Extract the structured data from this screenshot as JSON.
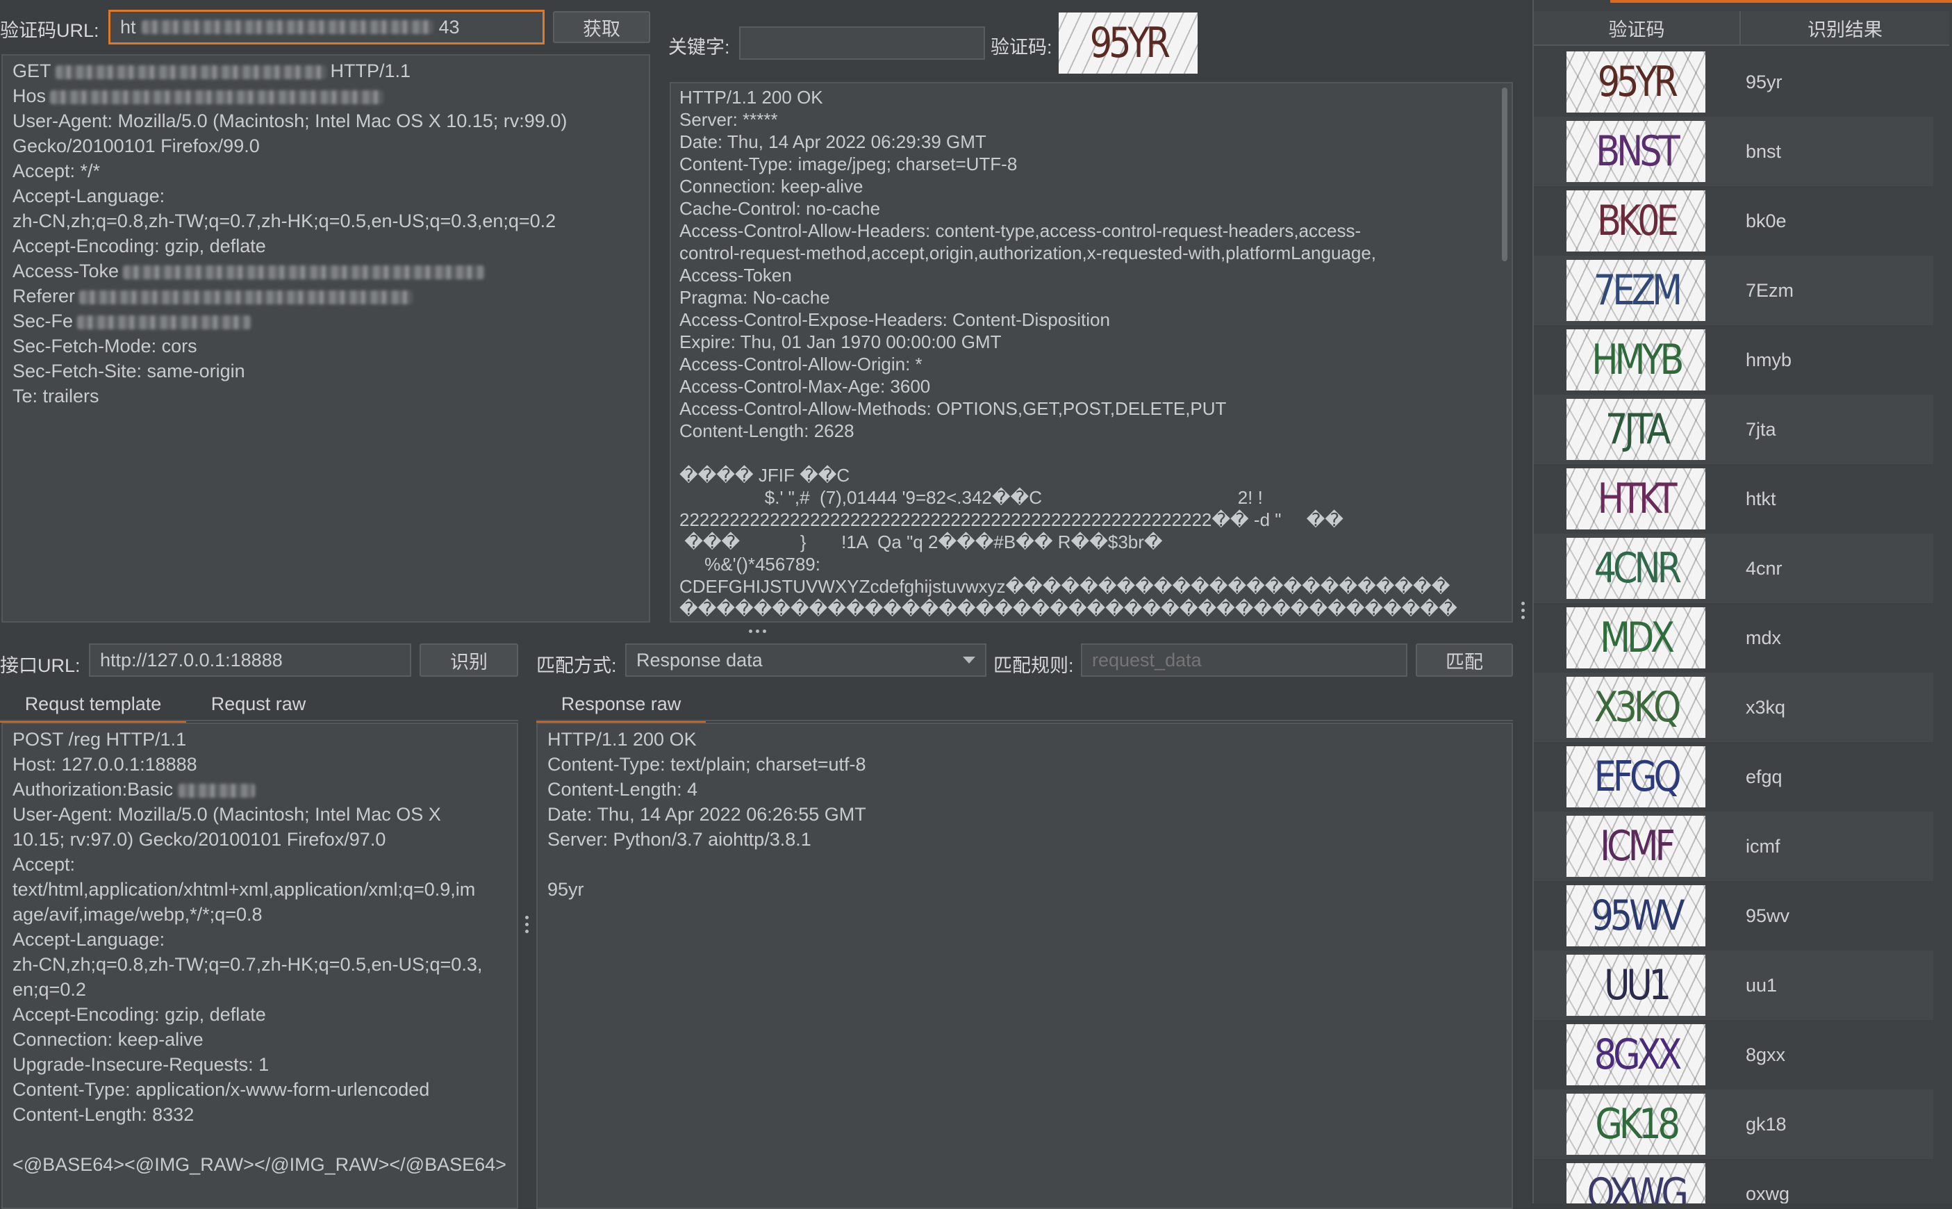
{
  "top": {
    "captcha_url_label": "验证码URL:",
    "captcha_url_value_start": "ht",
    "captcha_url_value_end": "43",
    "fetch_button": "获取",
    "keyword_label": "关键字:",
    "captcha_label": "验证码:",
    "captcha_text": "95YR"
  },
  "request_lines": [
    "GET",
    "Hos",
    "User-Agent: Mozilla/5.0 (Macintosh; Intel Mac OS X 10.15; rv:99.0)",
    "Gecko/20100101 Firefox/99.0",
    "Accept: */*",
    "Accept-Language:",
    "zh-CN,zh;q=0.8,zh-TW;q=0.7,zh-HK;q=0.5,en-US;q=0.3,en;q=0.2",
    "Accept-Encoding: gzip, deflate",
    "Access-Toke",
    "Referer",
    "Sec-Fe",
    "Sec-Fetch-Mode: cors",
    "Sec-Fetch-Site: same-origin",
    "Te: trailers"
  ],
  "request_line0_tail": "HTTP/1.1",
  "response_lines": [
    "HTTP/1.1 200 OK",
    "Server: *****",
    "Date: Thu, 14 Apr 2022 06:29:39 GMT",
    "Content-Type: image/jpeg; charset=UTF-8",
    "Connection: keep-alive",
    "Cache-Control: no-cache",
    "Access-Control-Allow-Headers: content-type,access-control-request-headers,access-",
    "control-request-method,accept,origin,authorization,x-requested-with,platformLanguage,",
    "Access-Token",
    "Pragma: No-cache",
    "Access-Control-Expose-Headers: Content-Disposition",
    "Expire: Thu, 01 Jan 1970 00:00:00 GMT",
    "Access-Control-Allow-Origin: *",
    "Access-Control-Max-Age: 3600",
    "Access-Control-Allow-Methods: OPTIONS,GET,POST,DELETE,PUT",
    "Content-Length: 2628",
    "",
    "���� JFIF ��C",
    "                 $.' \",#  (7),01444 '9=82<.342��C                                       2! !",
    "22222222222222222222222222222222222222222222222222222�� -d \"     ��",
    " ���            }       !1A  Qa \"q 2���#B�� R��$3br�",
    "     %&'()*456789:",
    "CDEFGHIJSTUVWXYZcdefghijstuvwxyz������������������������",
    "������������������������������������������"
  ],
  "middle": {
    "api_url_label": "接口URL:",
    "api_url_value": "http://127.0.0.1:18888",
    "recognize_button": "识别",
    "match_mode_label": "匹配方式:",
    "match_mode_value": "Response data",
    "match_rule_label": "匹配规则:",
    "match_rule_placeholder": "request_data",
    "match_button": "匹配"
  },
  "tabs": {
    "template": "Requst template",
    "raw": "Requst raw",
    "response_raw": "Response raw"
  },
  "template_lines": [
    "POST /reg HTTP/1.1",
    "Host: 127.0.0.1:18888",
    "Authorization:Basic",
    "User-Agent: Mozilla/5.0 (Macintosh; Intel Mac OS X",
    "10.15; rv:97.0) Gecko/20100101 Firefox/97.0",
    "Accept:",
    "text/html,application/xhtml+xml,application/xml;q=0.9,im",
    "age/avif,image/webp,*/*;q=0.8",
    "Accept-Language:",
    "zh-CN,zh;q=0.8,zh-TW;q=0.7,zh-HK;q=0.5,en-US;q=0.3,",
    "en;q=0.2",
    "Accept-Encoding: gzip, deflate",
    "Connection: keep-alive",
    "Upgrade-Insecure-Requests: 1",
    "Content-Type: application/x-www-form-urlencoded",
    "Content-Length: 8332",
    "",
    "<@BASE64><@IMG_RAW></@IMG_RAW></@BASE64>"
  ],
  "response_raw_lines": [
    "HTTP/1.1 200 OK",
    "Content-Type: text/plain; charset=utf-8",
    "Content-Length: 4",
    "Date: Thu, 14 Apr 2022 06:26:55 GMT",
    "Server: Python/3.7 aiohttp/3.8.1",
    "",
    "95yr"
  ],
  "history": {
    "col_captcha": "验证码",
    "col_result": "识别结果",
    "rows": [
      {
        "captcha": "95YR",
        "result": "95yr",
        "color": "#5a2a22"
      },
      {
        "captcha": "BNST",
        "result": "bnst",
        "color": "#5a2d6e"
      },
      {
        "captcha": "BK0E",
        "result": "bk0e",
        "color": "#6a2a3a"
      },
      {
        "captcha": "7EZM",
        "result": "7Ezm",
        "color": "#2f4a78"
      },
      {
        "captcha": "HMYB",
        "result": "hmyb",
        "color": "#2e6a3a"
      },
      {
        "captcha": "7JTA",
        "result": "7jta",
        "color": "#2a5a3a"
      },
      {
        "captcha": "HTKT",
        "result": "htkt",
        "color": "#6a2a5a"
      },
      {
        "captcha": "4CNR",
        "result": "4cnr",
        "color": "#2e6a4a"
      },
      {
        "captcha": "MDX",
        "result": "mdx",
        "color": "#2e6e3a"
      },
      {
        "captcha": "X3KQ",
        "result": "x3kq",
        "color": "#3a6a3a"
      },
      {
        "captcha": "EFGQ",
        "result": "efgq",
        "color": "#2a3a7a"
      },
      {
        "captcha": "ICMF",
        "result": "icmf",
        "color": "#5a2a5a"
      },
      {
        "captcha": "95WV",
        "result": "95wv",
        "color": "#2a3a6e"
      },
      {
        "captcha": "UU1",
        "result": "uu1",
        "color": "#2a2a4a"
      },
      {
        "captcha": "8GXX",
        "result": "8gxx",
        "color": "#4a2a7a"
      },
      {
        "captcha": "GK18",
        "result": "gk18",
        "color": "#2e6a3a"
      },
      {
        "captcha": "OXWG",
        "result": "oxwg",
        "color": "#3a3a6a"
      }
    ]
  }
}
